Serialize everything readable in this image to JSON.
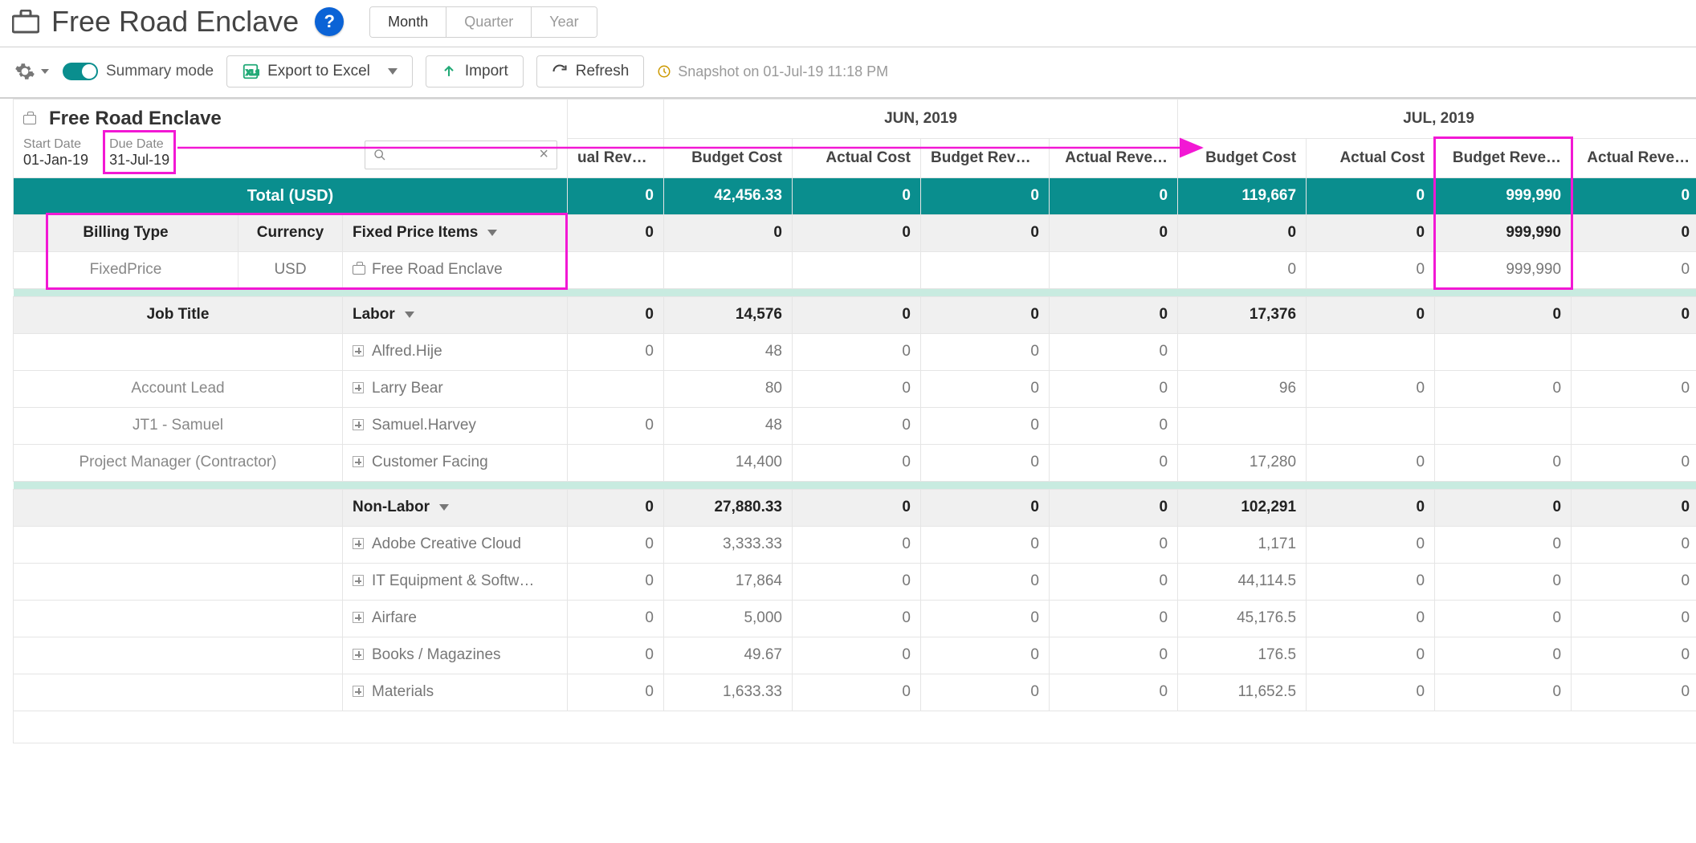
{
  "title": "Free Road Enclave",
  "period_buttons": {
    "month": "Month",
    "quarter": "Quarter",
    "year": "Year",
    "active": "month"
  },
  "toolbar": {
    "summary": "Summary mode",
    "export": "Export to Excel",
    "import": "Import",
    "refresh": "Refresh",
    "snapshot_prefix": "Snapshot on ",
    "snapshot_value": "01-Jul-19 11:18 PM"
  },
  "project": {
    "name": "Free Road Enclave",
    "start_label": "Start Date",
    "start_value": "01-Jan-19",
    "due_label": "Due Date",
    "due_value": "31-Jul-19",
    "search_placeholder": ""
  },
  "periods": [
    "JUN, 2019",
    "JUL, 2019"
  ],
  "columns": [
    "Budget Cost",
    "Actual Cost",
    "Budget Reve…",
    "Actual Reve…"
  ],
  "prev_col_label": "ual Reve…",
  "total_label": "Total (USD)",
  "totals": {
    "prev": "0",
    "jun": [
      "42,456.33",
      "0",
      "0",
      "0"
    ],
    "jul": [
      "119,667",
      "0",
      "999,990",
      "0"
    ]
  },
  "fixed_price": {
    "head": {
      "billing": "Billing Type",
      "currency": "Currency",
      "items": "Fixed Price Items"
    },
    "sum": {
      "prev": "0",
      "jun": [
        "0",
        "0",
        "0",
        "0"
      ],
      "jul": [
        "0",
        "0",
        "999,990",
        "0"
      ]
    },
    "row": {
      "billing": "FixedPrice",
      "currency": "USD",
      "name": "Free Road Enclave",
      "prev": "",
      "jun": [
        "",
        "",
        "",
        ""
      ],
      "jul": [
        "0",
        "0",
        "999,990",
        "0"
      ]
    }
  },
  "labor": {
    "head": {
      "job": "Job Title",
      "label": "Labor"
    },
    "sum": {
      "prev": "0",
      "jun": [
        "14,576",
        "0",
        "0",
        "0"
      ],
      "jul": [
        "17,376",
        "0",
        "0",
        "0"
      ]
    },
    "rows": [
      {
        "job": "",
        "name": "Alfred.Hije",
        "prev": "0",
        "jun": [
          "48",
          "0",
          "0",
          "0"
        ],
        "jul": [
          "",
          "",
          "",
          ""
        ]
      },
      {
        "job": "Account Lead",
        "name": "Larry Bear",
        "prev": "",
        "jun": [
          "80",
          "0",
          "0",
          "0"
        ],
        "jul": [
          "96",
          "0",
          "0",
          "0"
        ]
      },
      {
        "job": "JT1 - Samuel",
        "name": "Samuel.Harvey",
        "prev": "0",
        "jun": [
          "48",
          "0",
          "0",
          "0"
        ],
        "jul": [
          "",
          "",
          "",
          ""
        ]
      },
      {
        "job": "Project Manager (Contractor)",
        "name": "Customer Facing",
        "prev": "",
        "jun": [
          "14,400",
          "0",
          "0",
          "0"
        ],
        "jul": [
          "17,280",
          "0",
          "0",
          "0"
        ]
      }
    ]
  },
  "nonlabor": {
    "label": "Non-Labor",
    "sum": {
      "prev": "0",
      "jun": [
        "27,880.33",
        "0",
        "0",
        "0"
      ],
      "jul": [
        "102,291",
        "0",
        "0",
        "0"
      ]
    },
    "rows": [
      {
        "name": "Adobe Creative Cloud",
        "prev": "0",
        "jun": [
          "3,333.33",
          "0",
          "0",
          "0"
        ],
        "jul": [
          "1,171",
          "0",
          "0",
          "0"
        ]
      },
      {
        "name": "IT Equipment & Softw…",
        "prev": "0",
        "jun": [
          "17,864",
          "0",
          "0",
          "0"
        ],
        "jul": [
          "44,114.5",
          "0",
          "0",
          "0"
        ]
      },
      {
        "name": "Airfare",
        "prev": "0",
        "jun": [
          "5,000",
          "0",
          "0",
          "0"
        ],
        "jul": [
          "45,176.5",
          "0",
          "0",
          "0"
        ]
      },
      {
        "name": "Books / Magazines",
        "prev": "0",
        "jun": [
          "49.67",
          "0",
          "0",
          "0"
        ],
        "jul": [
          "176.5",
          "0",
          "0",
          "0"
        ]
      },
      {
        "name": "Materials",
        "prev": "0",
        "jun": [
          "1,633.33",
          "0",
          "0",
          "0"
        ],
        "jul": [
          "11,652.5",
          "0",
          "0",
          "0"
        ]
      }
    ]
  },
  "annotation_targets": {
    "arrow_from": "due-date-box",
    "arrow_to": "july-header",
    "highlight_column": "jul_budget_revenue"
  }
}
